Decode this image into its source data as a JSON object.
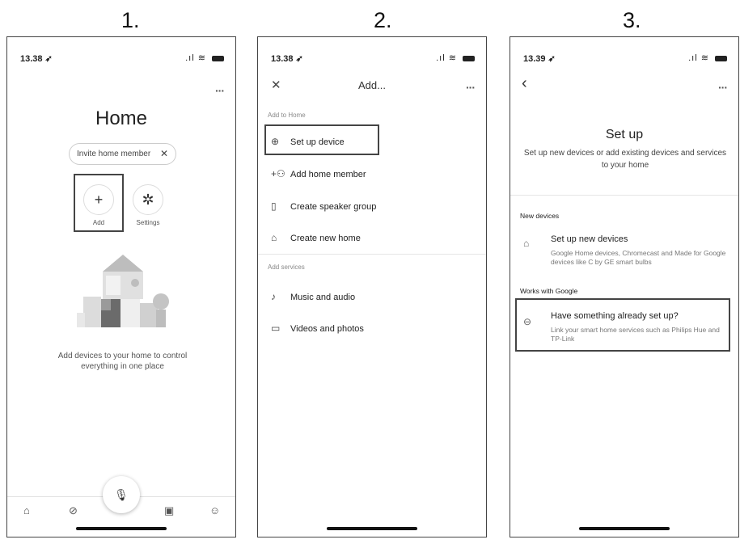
{
  "steps": [
    "1.",
    "2.",
    "3."
  ],
  "phone1": {
    "time": "13.38 ➶",
    "title": "Home",
    "invite_chip": "Invite home member",
    "add_label": "Add",
    "settings_label": "Settings",
    "message": "Add devices to your home to control everything in one place",
    "more": "···"
  },
  "phone2": {
    "time": "13.38 ➶",
    "title": "Add...",
    "more": "···",
    "section_add_to_home": "Add to Home",
    "items_home": [
      "Set up device",
      "Add home member",
      "Create speaker group",
      "Create new home"
    ],
    "section_add_services": "Add services",
    "items_services": [
      "Music and audio",
      "Videos and photos"
    ]
  },
  "phone3": {
    "time": "13.39 ➶",
    "more": "···",
    "title": "Set up",
    "subtitle": "Set up new devices or add existing devices and services to your home",
    "section_new_devices": "New devices",
    "new_devices_title": "Set up new devices",
    "new_devices_desc": "Google Home devices, Chromecast and Made for Google devices like C by GE smart bulbs",
    "section_works_with": "Works with Google",
    "works_title": "Have something already set up?",
    "works_desc": "Link your smart home services such as Philips Hue and TP-Link"
  },
  "icons": [
    "wifi-icon",
    "battery-icon",
    "more-icon",
    "plus-icon",
    "gear-icon",
    "mic-icon",
    "home-nav-icon",
    "explore-nav-icon",
    "media-nav-icon",
    "account-nav-icon",
    "close-icon",
    "back-icon",
    "link-icon",
    "house-icon"
  ]
}
